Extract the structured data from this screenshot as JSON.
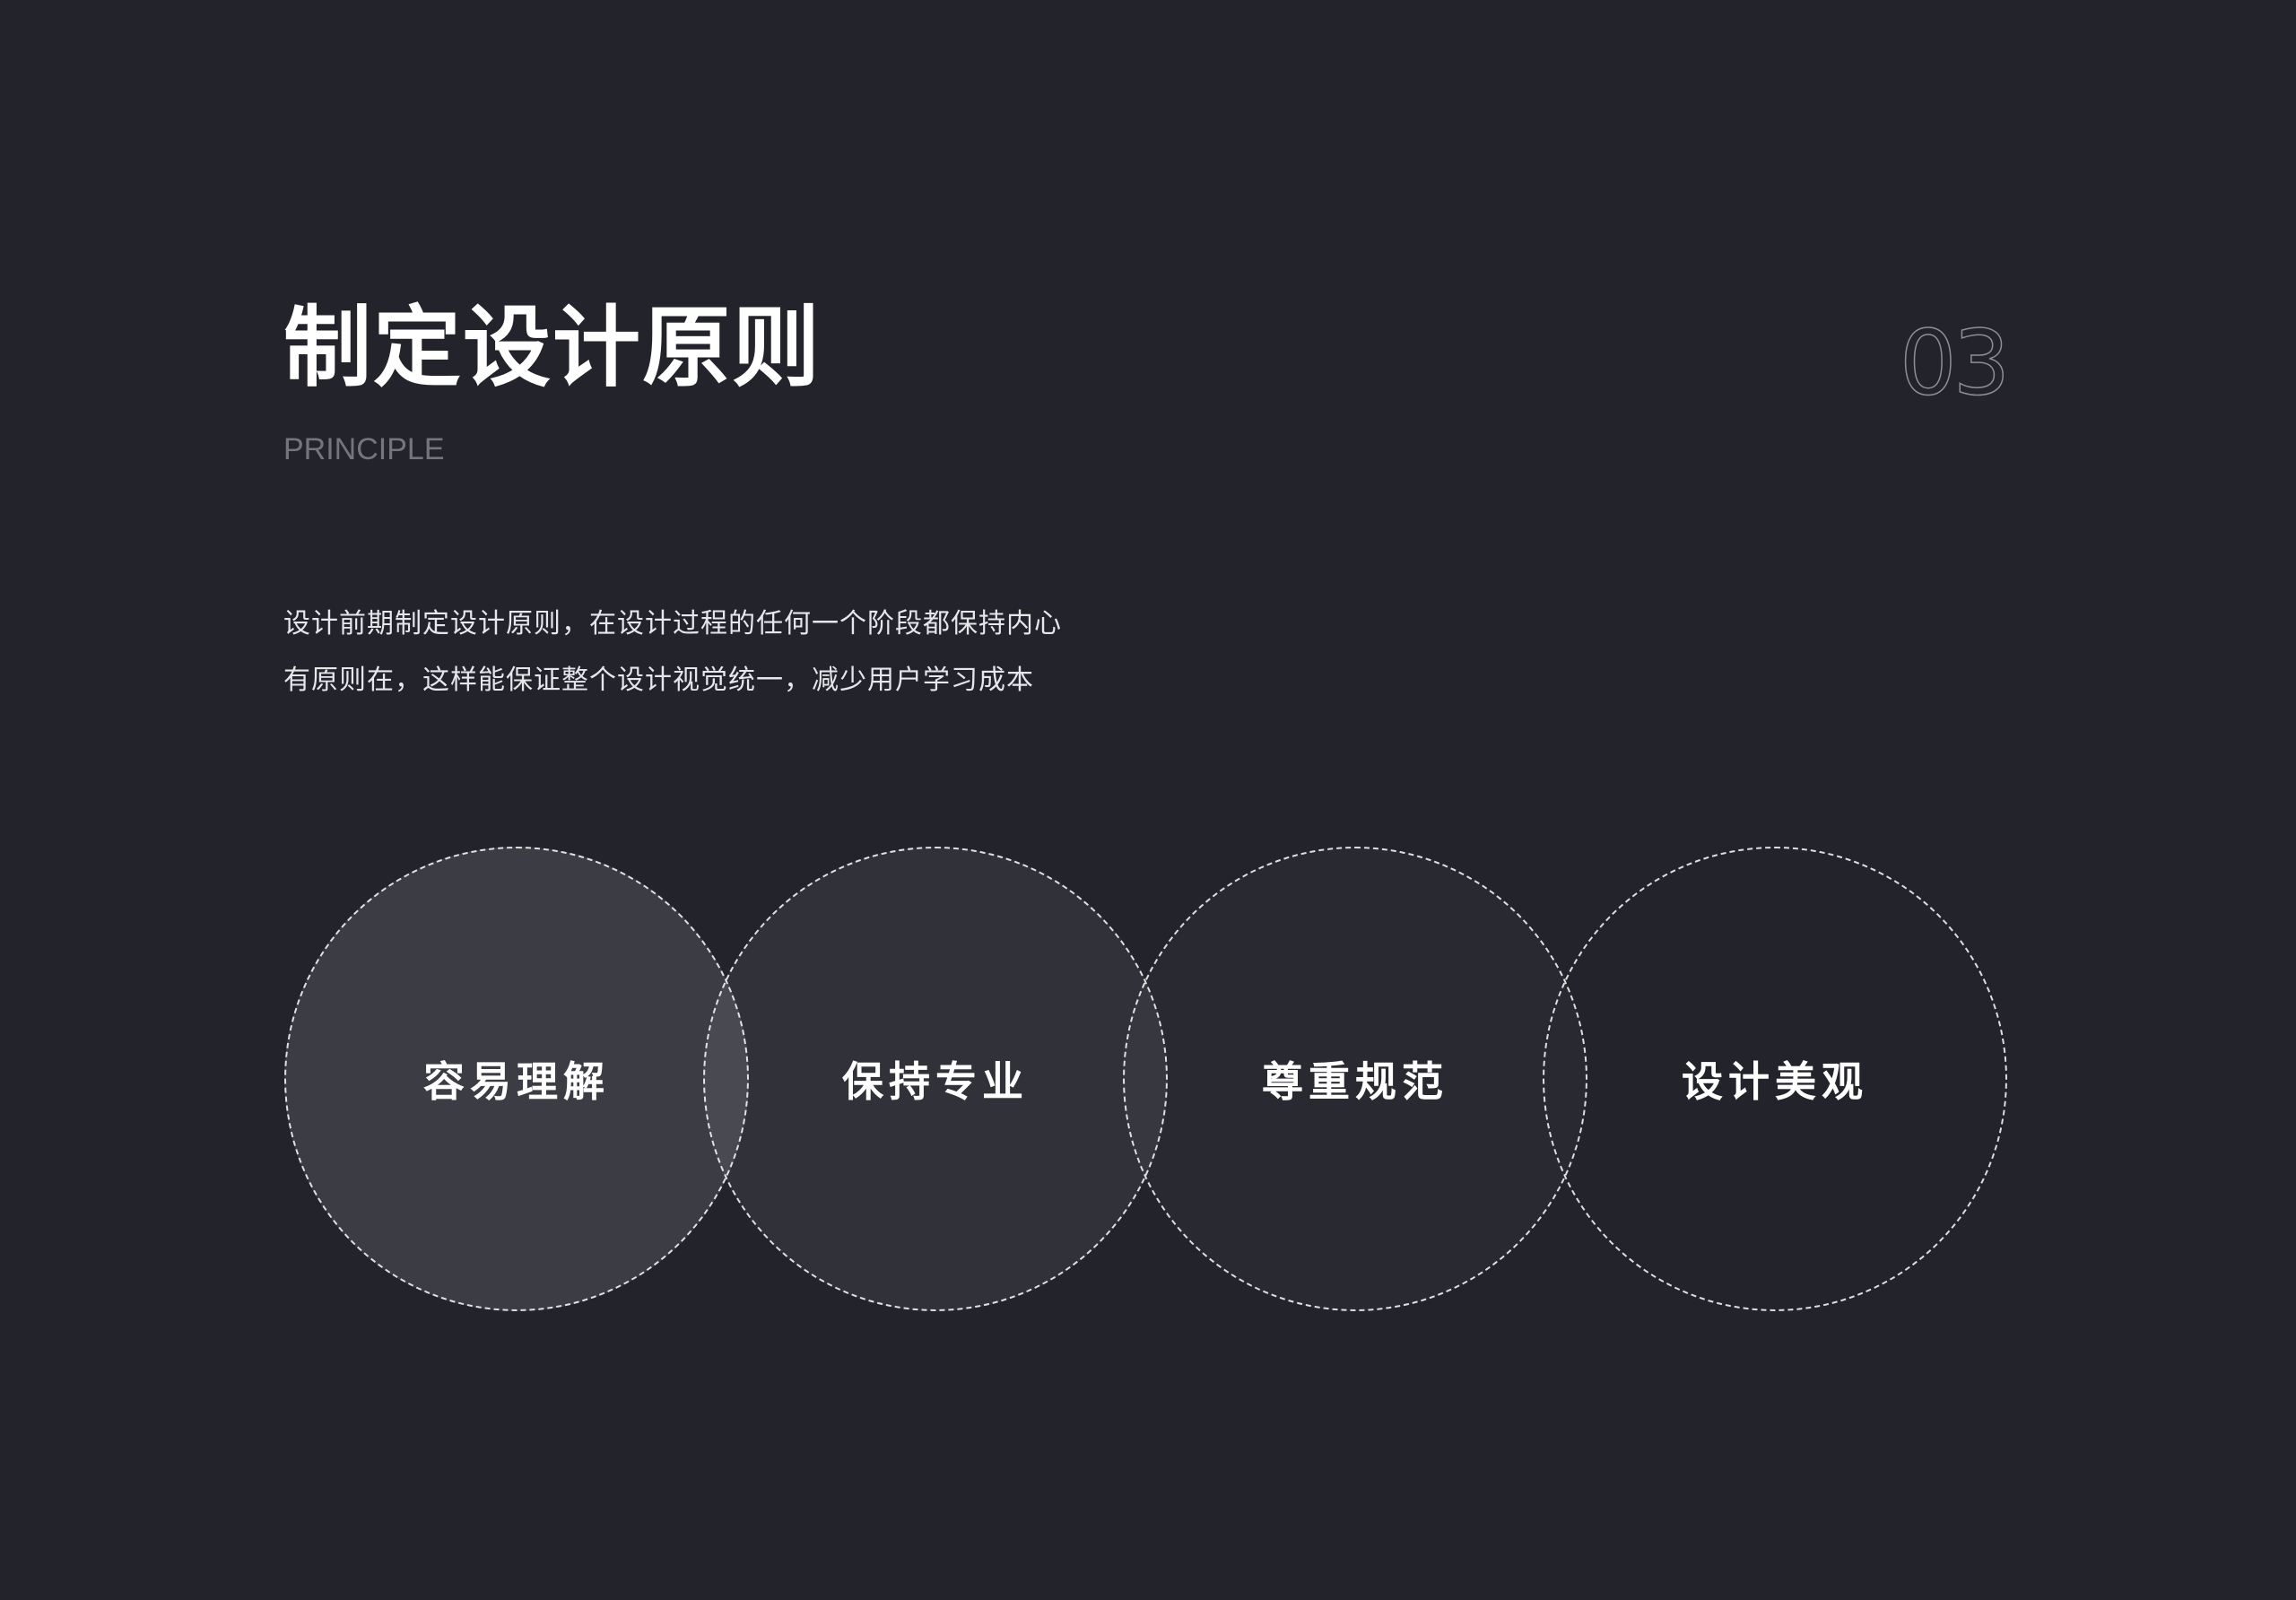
{
  "header": {
    "title": "制定设计原则",
    "subtitle": "PRINCIPLE",
    "page_number": "03"
  },
  "description": {
    "line1": "设计前期制定设计原则，在设计过程的任何一个阶段都保持内心",
    "line2": "有原则在，这样能保证整个设计视觉统一，减少用户学习成本"
  },
  "principles": [
    {
      "label": "容易理解",
      "fill": "rgba(255,255,255,0.12)"
    },
    {
      "label": "保持专业",
      "fill": "rgba(255,255,255,0.07)"
    },
    {
      "label": "尊重规范",
      "fill": "rgba(255,255,255,0.03)"
    },
    {
      "label": "设计美观",
      "fill": "rgba(255,255,255,0.0)"
    }
  ],
  "colors": {
    "background": "#22232b",
    "text": "#ffffff",
    "muted": "#74757d"
  }
}
